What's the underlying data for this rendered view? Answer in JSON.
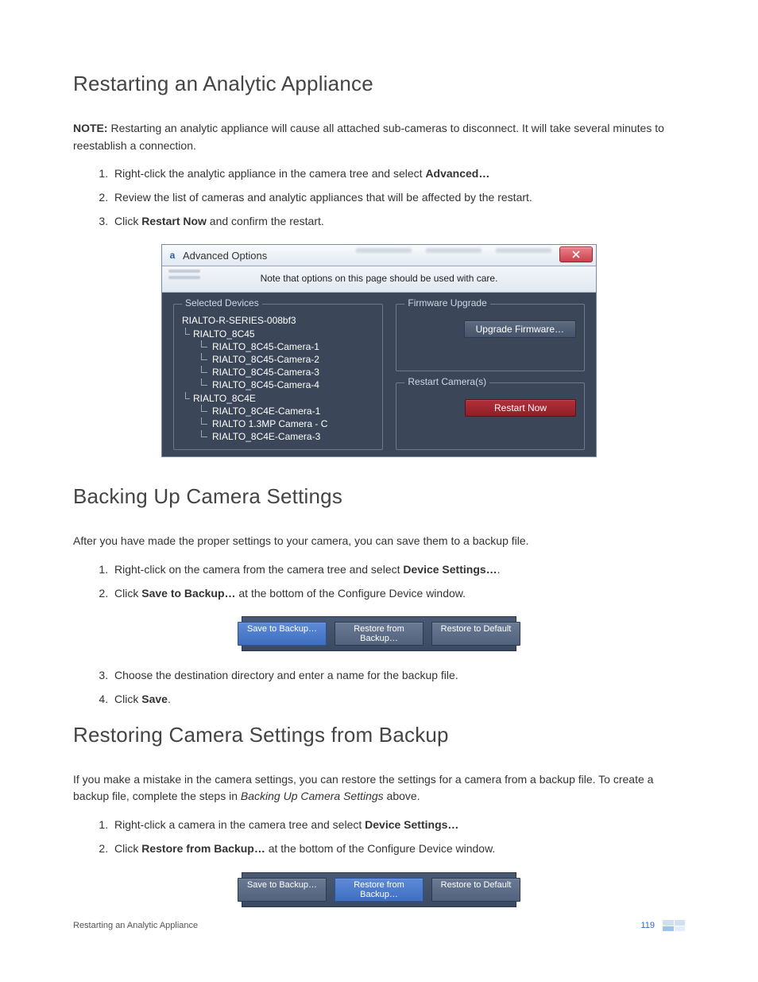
{
  "sections": {
    "restart": {
      "heading": "Restarting an Analytic Appliance",
      "note_label": "NOTE:",
      "note_text": " Restarting an analytic appliance will cause all attached sub-cameras to disconnect. It will take several minutes to reestablish a connection.",
      "steps": {
        "s1a": "Right-click the analytic appliance in the camera tree and select ",
        "s1b": "Advanced…",
        "s2": "Review the list of cameras and analytic appliances that will be affected by the restart.",
        "s3a": "Click ",
        "s3b": "Restart Now",
        "s3c": " and confirm the restart."
      }
    },
    "backup": {
      "heading": "Backing Up Camera Settings",
      "intro": "After you have made the proper settings to your camera, you can save them to a backup file.",
      "steps": {
        "s1a": "Right-click on the camera from the camera tree and select ",
        "s1b": "Device Settings…",
        "s1c": ".",
        "s2a": "Click ",
        "s2b": "Save to Backup…",
        "s2c": " at the bottom of the Configure Device window.",
        "s3": "Choose the destination directory and enter a name for the backup file.",
        "s4a": "Click ",
        "s4b": "Save",
        "s4c": "."
      }
    },
    "restore": {
      "heading": "Restoring Camera Settings from Backup",
      "intro_a": "If you make a mistake in the camera settings, you can restore the settings for a camera from a backup file. To create a backup file, complete the steps in ",
      "intro_em": "Backing Up Camera Settings",
      "intro_b": " above.",
      "steps": {
        "s1a": "Right-click a camera in the camera tree and select ",
        "s1b": "Device Settings…",
        "s2a": "Click ",
        "s2b": "Restore from Backup…",
        "s2c": " at the bottom of the Configure Device window."
      }
    }
  },
  "dialog": {
    "title": "Advanced Options",
    "banner": "Note that options on this page should be used with care.",
    "selected_devices_label": "Selected Devices",
    "firmware_upgrade_label": "Firmware Upgrade",
    "restart_cameras_label": "Restart Camera(s)",
    "upgrade_btn": "Upgrade Firmware…",
    "restart_btn": "Restart Now",
    "tree": {
      "root": "RIALTO-R-SERIES-008bf3",
      "g1": "RIALTO_8C45",
      "g1c1": "RIALTO_8C45-Camera-1",
      "g1c2": "RIALTO_8C45-Camera-2",
      "g1c3": "RIALTO_8C45-Camera-3",
      "g1c4": "RIALTO_8C45-Camera-4",
      "g2": "RIALTO_8C4E",
      "g2c1": "RIALTO_8C4E-Camera-1",
      "g2c2": "RIALTO 1.3MP Camera - C",
      "g2c3": "RIALTO_8C4E-Camera-3"
    }
  },
  "bar": {
    "save": "Save to Backup…",
    "restore": "Restore from Backup…",
    "default": "Restore to Default"
  },
  "footer": {
    "left": "Restarting an Analytic Appliance",
    "page": "119"
  }
}
